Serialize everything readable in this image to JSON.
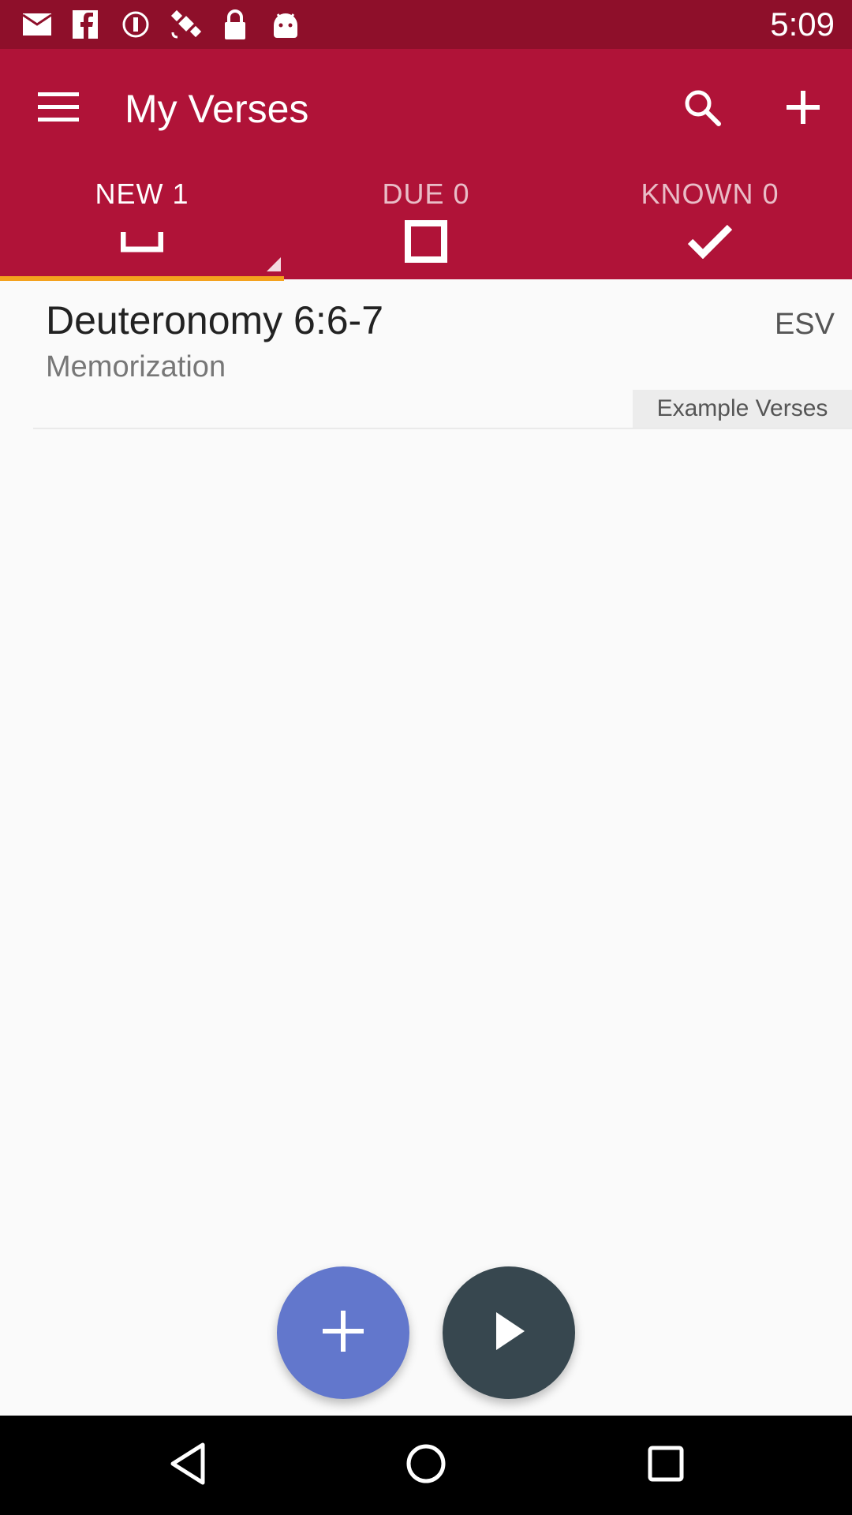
{
  "status_bar": {
    "time": "5:09",
    "icons": [
      "mail-icon",
      "facebook-icon",
      "sync-icon",
      "satellite-icon",
      "lock-icon",
      "android-icon"
    ]
  },
  "app_bar": {
    "title": "My Verses",
    "icons": {
      "menu": "menu-icon",
      "search": "search-icon",
      "add": "plus-icon"
    },
    "color": "#b01338"
  },
  "tabs": [
    {
      "label": "NEW 1",
      "icon": "bracket-icon",
      "active": true
    },
    {
      "label": "DUE 0",
      "icon": "square-icon",
      "active": false
    },
    {
      "label": "KNOWN 0",
      "icon": "check-icon",
      "active": false
    }
  ],
  "accent_color": "#f4a21e",
  "verses": [
    {
      "reference": "Deuteronomy 6:6-7",
      "version": "ESV",
      "subtitle": "Memorization",
      "tag": "Example Verses"
    }
  ],
  "fabs": {
    "add_icon": "plus-icon",
    "play_icon": "play-icon"
  },
  "nav": {
    "back": "back-icon",
    "home": "home-icon",
    "recents": "recents-icon"
  }
}
